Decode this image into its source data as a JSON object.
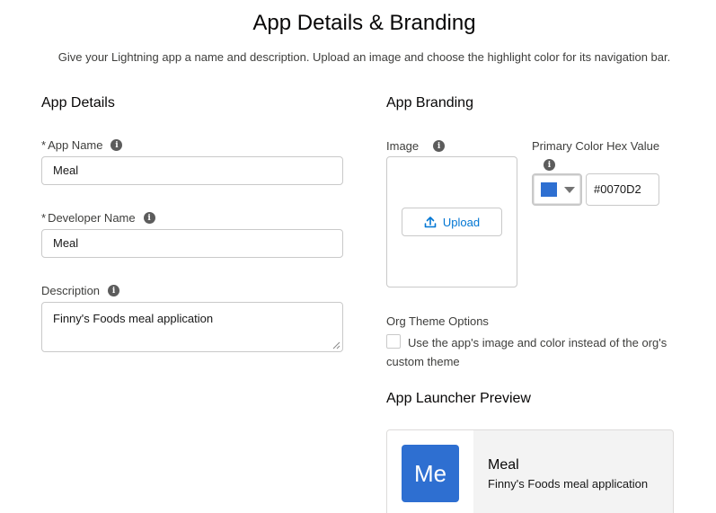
{
  "header": {
    "title": "App Details & Branding",
    "subtitle": "Give your Lightning app a name and description. Upload an image and choose the highlight color for its navigation bar."
  },
  "app_details": {
    "heading": "App Details",
    "required_marker": "*",
    "app_name": {
      "label": "App Name",
      "value": "Meal",
      "info_icon": "info-icon"
    },
    "developer_name": {
      "label": "Developer Name",
      "value": "Meal",
      "info_icon": "info-icon"
    },
    "description": {
      "label": "Description",
      "value": "Finny's Foods meal application",
      "info_icon": "info-icon"
    }
  },
  "app_branding": {
    "heading": "App Branding",
    "image": {
      "label": "Image",
      "upload_label": "Upload",
      "upload_icon": "upload-icon"
    },
    "primary_color": {
      "label": "Primary Color Hex Value",
      "value": "#0070D2",
      "swatch_color": "#2e6fd1"
    },
    "org_theme": {
      "label": "Org Theme Options",
      "checkbox_label": "Use the app's image and color instead of the org's custom theme",
      "checked": false
    }
  },
  "launcher_preview": {
    "heading": "App Launcher Preview",
    "tile_initials": "Me",
    "tile_color": "#2e6fd1",
    "app_name": "Meal",
    "app_description": "Finny's Foods meal application"
  },
  "colors": {
    "accent": "#0176d3",
    "border": "#c9c9c9",
    "text": "#181818"
  }
}
